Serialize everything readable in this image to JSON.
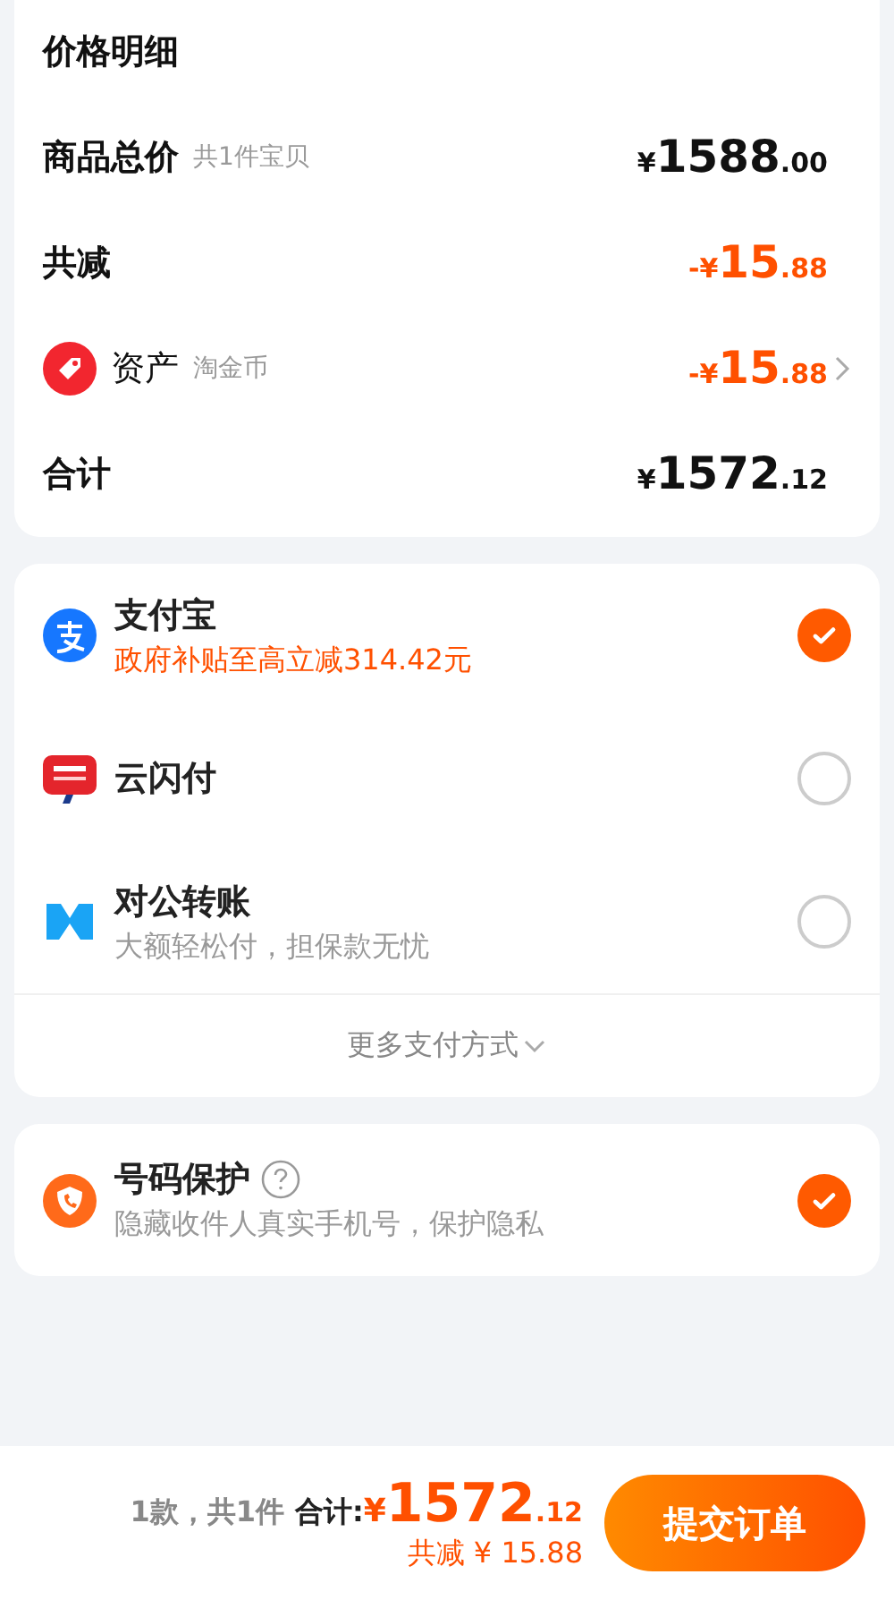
{
  "price_detail": {
    "title": "价格明细",
    "rows": [
      {
        "kind": "total",
        "label": "商品总价",
        "note": "共1件宝贝",
        "amount": {
          "currency": "¥",
          "integer": "1588",
          "decimal": ".00"
        }
      },
      {
        "kind": "discount",
        "label": "共减",
        "amount": {
          "sign": "-",
          "currency": "¥",
          "integer": "15",
          "decimal": ".88"
        }
      },
      {
        "kind": "asset",
        "label": "资产",
        "note": "淘金币",
        "amount": {
          "sign": "-",
          "currency": "¥",
          "integer": "15",
          "decimal": ".88"
        }
      },
      {
        "kind": "total",
        "label": "合计",
        "amount": {
          "currency": "¥",
          "integer": "1572",
          "decimal": ".12"
        }
      }
    ]
  },
  "payment": {
    "methods": [
      {
        "kind": "alipay",
        "name": "支付宝",
        "subtitle": "政府补贴至高立减314.42元",
        "promo": true,
        "selected": true
      },
      {
        "kind": "unionpay",
        "name": "云闪付",
        "selected": false
      },
      {
        "kind": "transfer",
        "name": "对公转账",
        "subtitle": "大额轻松付，担保款无忧",
        "promo": false,
        "selected": false
      }
    ],
    "more": "更多支付方式"
  },
  "protection": {
    "name": "号码保护",
    "description": "隐藏收件人真实手机号，保护隐私",
    "checked": true
  },
  "footer": {
    "count": "1款，共1件",
    "total_label": "合计:",
    "currency": "¥",
    "integer": "1572",
    "decimal": ".12",
    "discount": "共减 ¥ 15.88",
    "submit": "提交订单"
  }
}
